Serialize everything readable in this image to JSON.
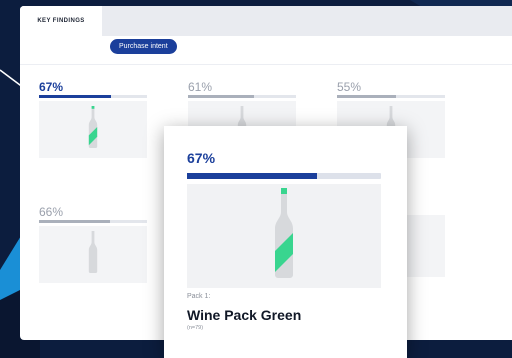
{
  "tabs": {
    "active": "KEY FINDINGS"
  },
  "filter": {
    "label": "Purchase intent"
  },
  "colors": {
    "accent": "#1b3f9b",
    "bottle_green": "#39d58f",
    "bottle_gray": "#d7d9dc",
    "background": "#0c1d3e"
  },
  "cards": [
    {
      "percent": "67%",
      "value": 0.67,
      "highlighted": true,
      "label_green": true
    },
    {
      "percent": "61%",
      "value": 0.61,
      "highlighted": false,
      "label_green": false
    },
    {
      "percent": "55%",
      "value": 0.55,
      "highlighted": false,
      "label_green": false
    },
    {
      "percent": "66%",
      "value": 0.66,
      "highlighted": false,
      "label_green": false
    }
  ],
  "detail": {
    "percent": "67%",
    "value": 0.67,
    "pack_label": "Pack 1:",
    "pack_name": "Wine Pack Green",
    "sample": "(n=79)",
    "stray_text": "r"
  },
  "icons": [
    "wine-bottle-icon"
  ]
}
